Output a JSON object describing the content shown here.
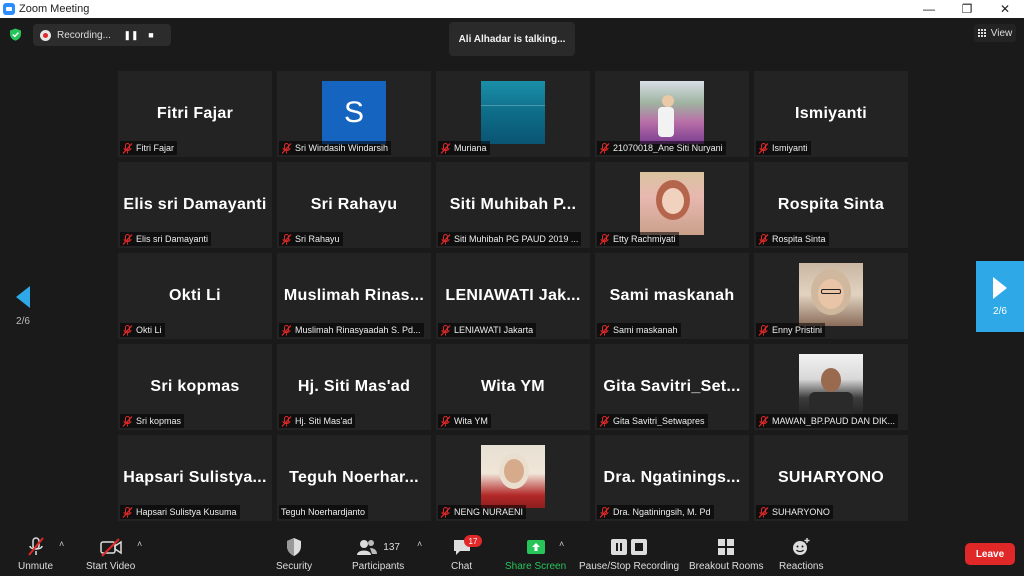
{
  "window": {
    "title": "Zoom Meeting",
    "minimize": "—",
    "restore": "❐",
    "close": "✕"
  },
  "recording": {
    "label": "Recording...",
    "pause": "❚❚",
    "stop": "■"
  },
  "talking": "Ali Alhadar is talking...",
  "view_label": "View",
  "pager": {
    "left": "2/6",
    "right": "2/6"
  },
  "participants": [
    {
      "display": "Fitri Fajar",
      "name": "Fitri Fajar",
      "muted": true,
      "video": "none"
    },
    {
      "display": "",
      "name": "Sri Windasih Windarsih",
      "muted": true,
      "video": "avatar-s",
      "avatar_letter": "S"
    },
    {
      "display": "",
      "name": "Muriana",
      "muted": true,
      "video": "sea"
    },
    {
      "display": "",
      "name": "21070018_Ane Siti Nuryani",
      "muted": true,
      "video": "flower"
    },
    {
      "display": "Ismiyanti",
      "name": "Ismiyanti",
      "muted": true,
      "video": "none"
    },
    {
      "display": "Elis sri Damayanti",
      "name": "Elis sri Damayanti",
      "muted": true,
      "video": "none"
    },
    {
      "display": "Sri Rahayu",
      "name": "Sri Rahayu",
      "muted": true,
      "video": "none"
    },
    {
      "display": "Siti Muhibah P...",
      "name": "Siti Muhibah PG PAUD 2019 ...",
      "muted": true,
      "video": "none"
    },
    {
      "display": "",
      "name": "Etty Rachmiyati",
      "muted": true,
      "video": "hijab"
    },
    {
      "display": "Rospita Sinta",
      "name": "Rospita Sinta",
      "muted": true,
      "video": "none"
    },
    {
      "display": "Okti Li",
      "name": "Okti Li",
      "muted": true,
      "video": "none"
    },
    {
      "display": "Muslimah Rinas...",
      "name": "Muslimah Rinasyaadah S. Pd...",
      "muted": true,
      "video": "none"
    },
    {
      "display": "LENIAWATI Jak...",
      "name": "LENIAWATI Jakarta",
      "muted": true,
      "video": "none"
    },
    {
      "display": "Sami maskanah",
      "name": "Sami maskanah",
      "muted": true,
      "video": "none"
    },
    {
      "display": "",
      "name": "Enny Pristini",
      "muted": true,
      "video": "woman2"
    },
    {
      "display": "Sri kopmas",
      "name": "Sri kopmas",
      "muted": true,
      "video": "none"
    },
    {
      "display": "Hj. Siti Mas'ad",
      "name": "Hj. Siti Mas'ad",
      "muted": true,
      "video": "none"
    },
    {
      "display": "Wita YM",
      "name": "Wita YM",
      "muted": true,
      "video": "none"
    },
    {
      "display": "Gita Savitri_Set...",
      "name": "Gita Savitri_Setwapres",
      "muted": true,
      "video": "none"
    },
    {
      "display": "",
      "name": "MAWAN_BP.PAUD DAN DIK...",
      "muted": true,
      "video": "man"
    },
    {
      "display": "Hapsari Sulistya...",
      "name": "Hapsari Sulistya Kusuma",
      "muted": true,
      "video": "none"
    },
    {
      "display": "Teguh Noerhar...",
      "name": "Teguh Noerhardjanto",
      "muted": false,
      "video": "none"
    },
    {
      "display": "",
      "name": "NENG NURAENI",
      "muted": true,
      "video": "neng"
    },
    {
      "display": "Dra. Ngatinings...",
      "name": "Dra. Ngatiningsih, M. Pd",
      "muted": true,
      "video": "none"
    },
    {
      "display": "SUHARYONO",
      "name": "SUHARYONO",
      "muted": true,
      "video": "none"
    }
  ],
  "toolbar": {
    "unmute": "Unmute",
    "start_video": "Start Video",
    "security": "Security",
    "participants": "Participants",
    "participants_count": "137",
    "chat": "Chat",
    "chat_badge": "17",
    "share_screen": "Share Screen",
    "pause_stop_recording": "Pause/Stop Recording",
    "breakout_rooms": "Breakout Rooms",
    "reactions": "Reactions",
    "leave": "Leave"
  },
  "colors": {
    "accent_blue": "#2ea8e6",
    "leave_red": "#e02828",
    "share_green": "#27c45a",
    "mute_red": "#e02828"
  }
}
